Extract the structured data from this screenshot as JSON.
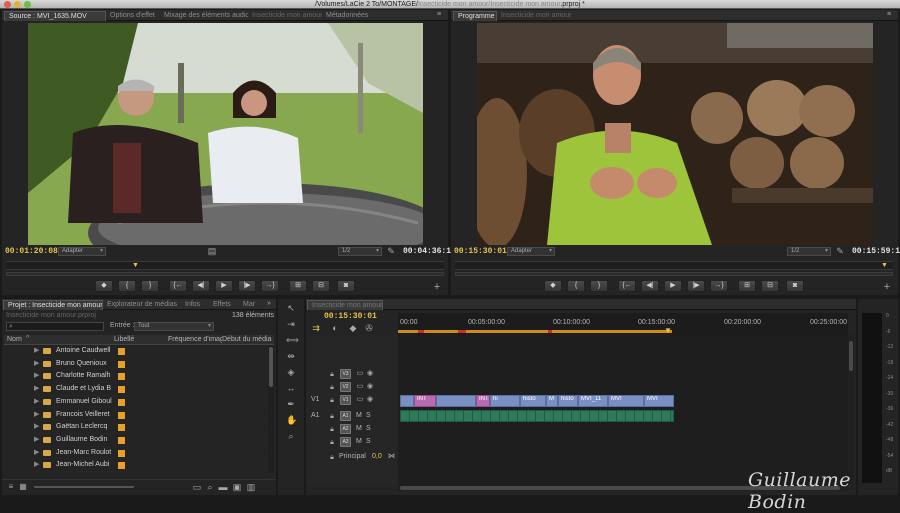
{
  "window": {
    "title": "/Volumes/LaCie 2 To/MONTAGE/",
    "title_dim": "Insecticide mon amour/Insecticide mon amour",
    "title_end": ".prproj *"
  },
  "source_monitor": {
    "tabs": [
      "Source : MVI_1635.MOV",
      "Options d'effet",
      "Mixage des éléments audio",
      "Insecticide mon amour",
      "Métadonnées"
    ],
    "timecode_in": "00:01:20:08",
    "fit": "Adapter",
    "resolution": "1/2",
    "duration": "00:04:36:12",
    "buttons": [
      "◆",
      "{",
      "}",
      "{←",
      "◀|",
      "▶",
      "|▶",
      "→}",
      "⊞",
      "⊟",
      "◙"
    ]
  },
  "program_monitor": {
    "tabs": [
      "Programme",
      "Insecticide mon amour"
    ],
    "timecode_in": "00:15:30:01",
    "fit": "Adapter",
    "resolution": "1/2",
    "duration": "00:15:59:10",
    "buttons": [
      "◆",
      "{",
      "}",
      "{←",
      "◀|",
      "▶",
      "|▶",
      "→}",
      "⊞",
      "⊟",
      "◙"
    ]
  },
  "project": {
    "tabs": [
      "Projet : Insecticide mon amour",
      "Explorateur de médias",
      "Infos",
      "Effets",
      "Mar"
    ],
    "project_file": "Insecticide mon amour.prproj",
    "count": "138 éléments",
    "search_placeholder": "",
    "entry_label": "Entrée :",
    "entry_value": "Tout",
    "columns": [
      "Nom",
      "Libellé",
      "Fréquence d'imag",
      "Début du média"
    ],
    "items": [
      "Antoine Caudwell",
      "Bruno Quenioux",
      "Charlotte Ramalh",
      "Claude et Lydia B",
      "Emmanuel Giboul",
      "Francois Veilleret",
      "Gaëtan Leclercq",
      "Guillaume Bodin",
      "Jean-Marc Roulot",
      "Jean-Michel Aubi"
    ]
  },
  "timeline": {
    "tab": "Insecticide mon amour",
    "timecode": "00:15:30:01",
    "ruler": [
      "00:00",
      "00:05:00:00",
      "00:10:00:00",
      "00:15:00:00",
      "00:20:00:00",
      "00:25:00:00"
    ],
    "tracks": [
      {
        "target": "",
        "name": "V3"
      },
      {
        "target": "",
        "name": "V2"
      },
      {
        "target": "V1",
        "name": "V1"
      },
      {
        "target": "A1",
        "name": "A1"
      },
      {
        "target": "",
        "name": "A2"
      },
      {
        "target": "",
        "name": "A3"
      }
    ],
    "master_label": "Principal",
    "master_value": "0,0",
    "video_clips": [
      "INT",
      "INT",
      "hi",
      "histo",
      "M",
      "histo",
      "MVI_11",
      "MVI",
      "MVI"
    ],
    "playhead_time": "00:15:30:01"
  },
  "watermark": "Guillaume Bodin",
  "colors": {
    "timecode": "#e5c44c",
    "label_orange": "#e8a028",
    "video_clip": "#7a8fc4",
    "audio_clip": "#2f7a5c",
    "playhead": "#d9781f"
  }
}
